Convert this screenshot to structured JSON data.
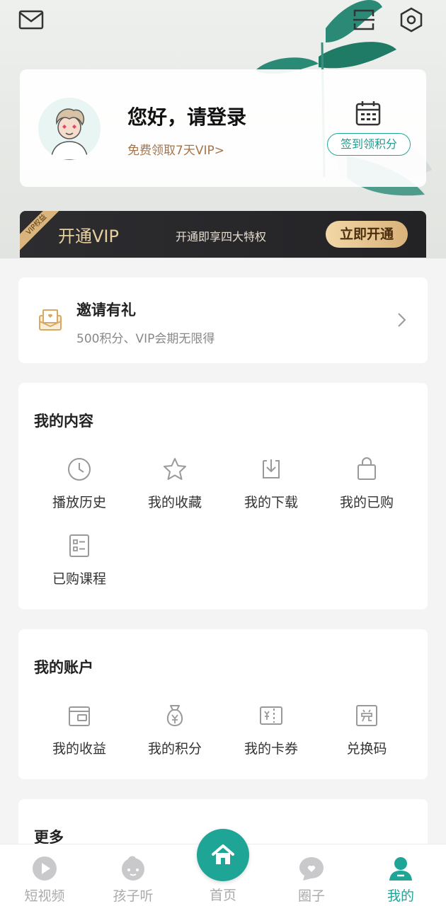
{
  "colors": {
    "accent": "#1fa596",
    "vip_gold": "#d9b27a",
    "vip_dark": "#29292c"
  },
  "header": {
    "icons": [
      "mail-icon",
      "scan-icon",
      "settings-icon"
    ]
  },
  "login": {
    "greeting": "您好，请登录",
    "vip_trial": "免费领取7天VIP>",
    "checkin": "签到领积分"
  },
  "vip_bar": {
    "ribbon": "VIP权益",
    "title": "开通VIP",
    "subtitle": "开通即享四大特权",
    "button": "立即开通"
  },
  "invite": {
    "title": "邀请有礼",
    "subtitle": "500积分、VIP会期无限得"
  },
  "my_content": {
    "title": "我的内容",
    "items": [
      {
        "label": "播放历史",
        "icon": "clock-icon"
      },
      {
        "label": "我的收藏",
        "icon": "star-icon"
      },
      {
        "label": "我的下载",
        "icon": "download-icon"
      },
      {
        "label": "我的已购",
        "icon": "bag-icon"
      },
      {
        "label": "已购课程",
        "icon": "course-list-icon"
      }
    ]
  },
  "my_account": {
    "title": "我的账户",
    "items": [
      {
        "label": "我的收益",
        "icon": "wallet-icon"
      },
      {
        "label": "我的积分",
        "icon": "money-bag-icon"
      },
      {
        "label": "我的卡券",
        "icon": "coupon-icon"
      },
      {
        "label": "兑换码",
        "icon": "redeem-icon"
      }
    ]
  },
  "more": {
    "title": "更多"
  },
  "nav": {
    "items": [
      {
        "label": "短视频",
        "icon": "play-icon"
      },
      {
        "label": "孩子听",
        "icon": "baby-icon"
      },
      {
        "label": "首页",
        "icon": "home-icon"
      },
      {
        "label": "圈子",
        "icon": "chat-bubble-icon"
      },
      {
        "label": "我的",
        "icon": "user-icon"
      }
    ],
    "active": "我的"
  }
}
